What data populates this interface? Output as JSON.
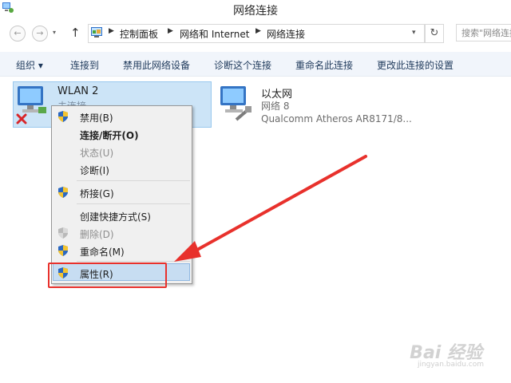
{
  "window": {
    "title": "网络连接"
  },
  "address_bar": {
    "breadcrumbs": [
      "控制面板",
      "网络和 Internet",
      "网络连接"
    ],
    "search_placeholder": "搜索\"网络连接\""
  },
  "toolbar": {
    "organize_label": "组织 ▾",
    "items": [
      "连接到",
      "禁用此网络设备",
      "诊断这个连接",
      "重命名此连接",
      "更改此连接的设置"
    ]
  },
  "connections": [
    {
      "name": "WLAN 2",
      "status": "未连接",
      "selected": true
    },
    {
      "name": "以太网",
      "status": "网络  8",
      "adapter": "Qualcomm Atheros AR8171/8..."
    }
  ],
  "context_menu": {
    "items": [
      {
        "label": "禁用(B)",
        "shield": true,
        "enabled": true,
        "bold": false
      },
      {
        "label": "连接/断开(O)",
        "shield": false,
        "enabled": true,
        "bold": true
      },
      {
        "label": "状态(U)",
        "shield": false,
        "enabled": false,
        "bold": false
      },
      {
        "label": "诊断(I)",
        "shield": false,
        "enabled": true,
        "bold": false
      },
      {
        "label": "桥接(G)",
        "shield": true,
        "enabled": true,
        "bold": false
      },
      {
        "label": "创建快捷方式(S)",
        "shield": false,
        "enabled": true,
        "bold": false
      },
      {
        "label": "删除(D)",
        "shield": true,
        "enabled": false,
        "bold": false
      },
      {
        "label": "重命名(M)",
        "shield": true,
        "enabled": true,
        "bold": false
      },
      {
        "label": "属性(R)",
        "shield": true,
        "enabled": true,
        "bold": false,
        "highlighted": true
      }
    ]
  },
  "watermark": {
    "text": "Bai 经验",
    "url": "jingyan.baidu.com"
  },
  "colors": {
    "annotation_red": "#e8312c",
    "selection": "#cce4f7",
    "toolbar_bg": "#f1f5fb"
  }
}
